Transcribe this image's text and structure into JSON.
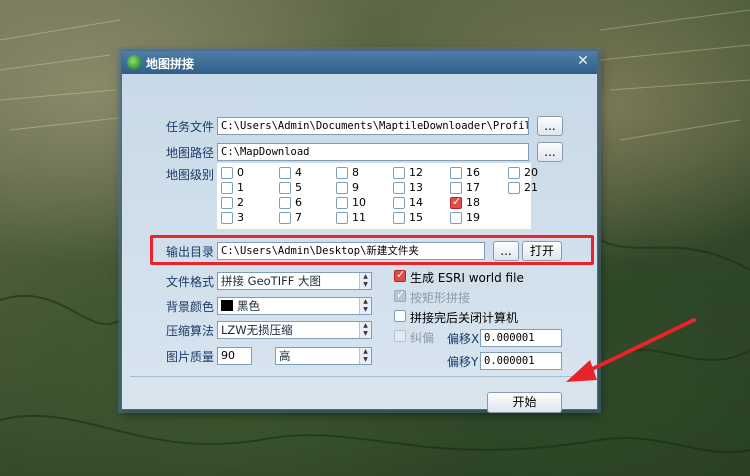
{
  "dialog": {
    "title": "地图拼接",
    "close": "✕"
  },
  "task_file": {
    "label": "任务文件",
    "value": "C:\\Users\\Admin\\Documents\\MaptileDownloader\\Profiles\\f",
    "browse": "..."
  },
  "map_path": {
    "label": "地图路径",
    "value": "C:\\MapDownload",
    "browse": "..."
  },
  "levels": {
    "label": "地图级别",
    "items": [
      {
        "label": "0",
        "checked": false
      },
      {
        "label": "1",
        "checked": false
      },
      {
        "label": "2",
        "checked": false
      },
      {
        "label": "3",
        "checked": false
      },
      {
        "label": "4",
        "checked": false
      },
      {
        "label": "5",
        "checked": false
      },
      {
        "label": "6",
        "checked": false
      },
      {
        "label": "7",
        "checked": false
      },
      {
        "label": "8",
        "checked": false
      },
      {
        "label": "9",
        "checked": false
      },
      {
        "label": "10",
        "checked": false
      },
      {
        "label": "11",
        "checked": false
      },
      {
        "label": "12",
        "checked": false
      },
      {
        "label": "13",
        "checked": false
      },
      {
        "label": "14",
        "checked": false
      },
      {
        "label": "15",
        "checked": false
      },
      {
        "label": "16",
        "checked": false
      },
      {
        "label": "17",
        "checked": false
      },
      {
        "label": "18",
        "checked": true
      },
      {
        "label": "19",
        "checked": false
      },
      {
        "label": "20",
        "checked": false
      },
      {
        "label": "21",
        "checked": false
      }
    ]
  },
  "output_dir": {
    "label": "输出目录",
    "value": "C:\\Users\\Admin\\Desktop\\新建文件夹",
    "browse": "...",
    "open": "打开"
  },
  "file_format": {
    "label": "文件格式",
    "value": "拼接 GeoTIFF 大图"
  },
  "bg_color": {
    "label": "背景颜色",
    "value": "黑色",
    "swatch": "#000000"
  },
  "compression": {
    "label": "压缩算法",
    "value": "LZW无损压缩"
  },
  "quality": {
    "label": "图片质量",
    "value": "90",
    "level": "高"
  },
  "options": {
    "esri_world_file": {
      "label": "生成 ESRI world file",
      "checked": true,
      "enabled": true
    },
    "rect_mosaic": {
      "label": "按矩形拼接",
      "checked": true,
      "enabled": false
    },
    "shutdown": {
      "label": "拼接完后关闭计算机",
      "checked": false,
      "enabled": true
    },
    "correction": {
      "label": "纠偏",
      "checked": false,
      "enabled": false
    }
  },
  "offset_x": {
    "label": "偏移X",
    "value": "0.000001"
  },
  "offset_y": {
    "label": "偏移Y",
    "value": "0.000001"
  },
  "start_button": "开始",
  "colors": {
    "highlight": "#e8232a",
    "arrow": "#e8232a",
    "titlebar": "#3d6d96"
  }
}
